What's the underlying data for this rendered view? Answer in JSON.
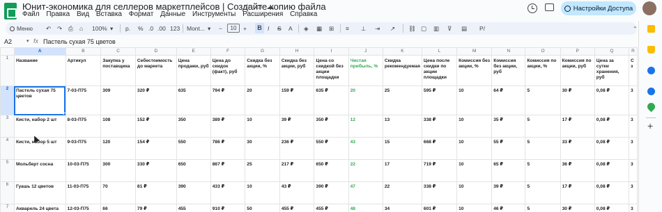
{
  "app": {
    "title": "Юнит-экономика для селлеров маркетплейсов | Создайте копию файла",
    "menu": [
      "Файл",
      "Правка",
      "Вид",
      "Вставка",
      "Формат",
      "Данные",
      "Инструменты",
      "Расширения",
      "Справка"
    ],
    "share_label": "Настройки Доступа"
  },
  "toolbar": {
    "search_label": "Меню",
    "zoom": "100%",
    "percent": "p.",
    "pct_sign": "%",
    "decimals_dec": ".0",
    "decimals_inc": ".00",
    "num_format": "123",
    "font": "Mont...",
    "font_minus": "−",
    "font_size": "10",
    "font_plus": "+",
    "bold": "B",
    "more": "Р/"
  },
  "formula_bar": {
    "cell_ref": "A2",
    "fx": "fx",
    "value": "Пастель сухая 75 цветов"
  },
  "sheet": {
    "columns": [
      "A",
      "B",
      "C",
      "D",
      "E",
      "F",
      "G",
      "H",
      "I",
      "J",
      "K",
      "L",
      "M",
      "N",
      "O",
      "P",
      "Q",
      "R"
    ],
    "row_numbers": [
      "1",
      "2",
      "3",
      "4",
      "5",
      "6",
      "7"
    ],
    "headers": [
      "Название",
      "Артикул",
      "Закупка у поставщика",
      "Себестоимость до маркета",
      "Цена продажи, руб",
      "Цена до скидок (факт), руб",
      "Скидка без акции, %",
      "Скидка без акции, руб",
      "Цена со скидкой без акции площадки",
      "Чистая прибыль, %",
      "Скидка рекомендуемая",
      "Цена после скидки по акции площадки",
      "Комиссия без акции, %",
      "Комиссия без акции, руб",
      "Комиссия по акции, %",
      "Комиссия по акции, руб",
      "Цена за сутки хранения, руб",
      "С з"
    ],
    "rows": [
      [
        "Пастель сухая 75 цветов",
        "7-03-П75",
        "309",
        "320 ₽",
        "635",
        "794 ₽",
        "20",
        "159 ₽",
        "635 ₽",
        "20",
        "25",
        "595 ₽",
        "10",
        "64 ₽",
        "5",
        "30 ₽",
        "0,08 ₽",
        "3"
      ],
      [
        "Кисти, набор 2 шт",
        "8-03-П75",
        "108",
        "152 ₽",
        "350",
        "389 ₽",
        "10",
        "39 ₽",
        "350 ₽",
        "12",
        "13",
        "338 ₽",
        "10",
        "35 ₽",
        "5",
        "17 ₽",
        "0,08 ₽",
        "3"
      ],
      [
        "Кисти, набор 5 шт",
        "9-03-П75",
        "120",
        "154 ₽",
        "550",
        "786 ₽",
        "30",
        "236 ₽",
        "550 ₽",
        "43",
        "15",
        "668 ₽",
        "10",
        "55 ₽",
        "5",
        "33 ₽",
        "0,08 ₽",
        "3"
      ],
      [
        "Мольберт сосна",
        "10-03-П75",
        "300",
        "330 ₽",
        "650",
        "867 ₽",
        "25",
        "217 ₽",
        "650 ₽",
        "22",
        "17",
        "719 ₽",
        "10",
        "65 ₽",
        "5",
        "36 ₽",
        "0,08 ₽",
        "3"
      ],
      [
        "Гуашь 12 цветов",
        "11-03-П75",
        "70",
        "81 ₽",
        "390",
        "433 ₽",
        "10",
        "43 ₽",
        "390 ₽",
        "47",
        "22",
        "338 ₽",
        "10",
        "39 ₽",
        "5",
        "17 ₽",
        "0,08 ₽",
        "3"
      ],
      [
        "Акварель 24 цвета",
        "12-03-П75",
        "66",
        "79 ₽",
        "455",
        "910 ₽",
        "50",
        "455 ₽",
        "455 ₽",
        "48",
        "34",
        "601 ₽",
        "10",
        "46 ₽",
        "5",
        "30 ₽",
        "0,08 ₽",
        "3"
      ]
    ]
  },
  "colors": {
    "accent": "#1a73e8",
    "share_bg": "#c2e7ff",
    "profit_green": "#34a853"
  },
  "icons": [
    "sheets-logo",
    "star-icon",
    "move-icon",
    "cloud-icon",
    "history-icon",
    "comment-icon",
    "globe-icon",
    "search-icon",
    "undo-icon",
    "redo-icon",
    "print-icon",
    "paint-format-icon",
    "calendar-icon",
    "keep-icon",
    "tasks-icon",
    "contacts-icon",
    "maps-icon",
    "plus-icon"
  ]
}
